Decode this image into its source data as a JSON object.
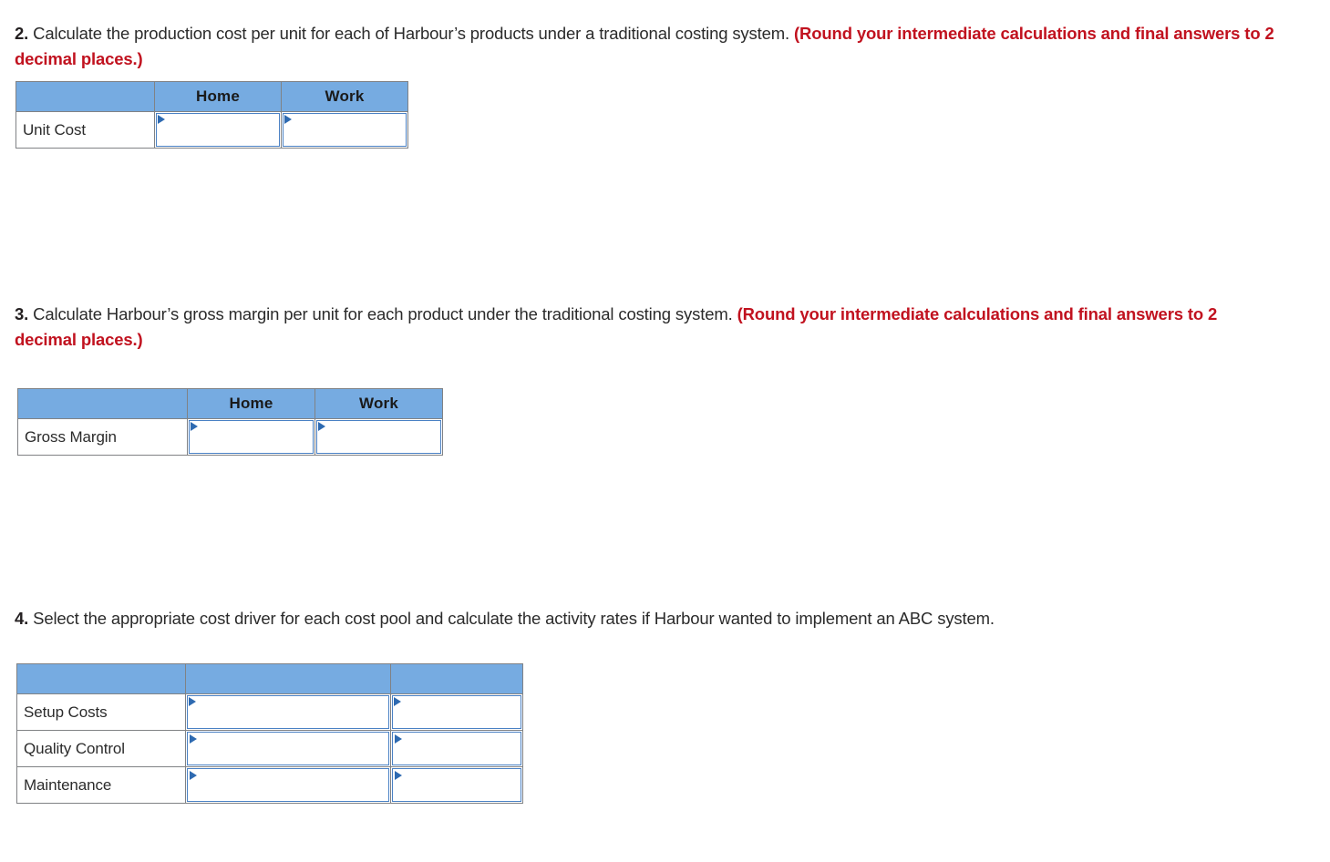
{
  "page": {
    "background": "#ffffff",
    "accent_blue": "#76abe1",
    "input_border_blue": "#4a81c4",
    "highlight_red": "#c1121f",
    "text_color": "#2b2b2b"
  },
  "questions": [
    {
      "number": "2.",
      "body": " Calculate the production cost per unit for each of Harbour’s products under a traditional costing system. ",
      "highlight": "(Round your intermediate calculations and final answers to 2 decimal places.)"
    },
    {
      "number": "3.",
      "body": " Calculate Harbour’s gross margin per unit for each product under the traditional costing system. ",
      "highlight": "(Round your intermediate calculations and final answers to 2 decimal places.)"
    },
    {
      "number": "4.",
      "body": " Select the appropriate cost driver for each cost pool and calculate the activity rates if Harbour wanted to implement an ABC system.",
      "highlight": ""
    }
  ],
  "tables": [
    {
      "id": "unit-cost-table",
      "headers": [
        "",
        "Home",
        "Work"
      ],
      "rows": [
        {
          "label": "Unit Cost",
          "cells": [
            "",
            ""
          ]
        }
      ]
    },
    {
      "id": "gross-margin-table",
      "headers": [
        "",
        "Home",
        "Work"
      ],
      "rows": [
        {
          "label": "Gross Margin",
          "cells": [
            "",
            ""
          ]
        }
      ]
    },
    {
      "id": "activity-rates-table",
      "headers": [
        "",
        "",
        ""
      ],
      "rows": [
        {
          "label": "Setup Costs",
          "cells": [
            "",
            ""
          ]
        },
        {
          "label": "Quality Control",
          "cells": [
            "",
            ""
          ]
        },
        {
          "label": "Maintenance",
          "cells": [
            "",
            ""
          ]
        }
      ]
    }
  ]
}
